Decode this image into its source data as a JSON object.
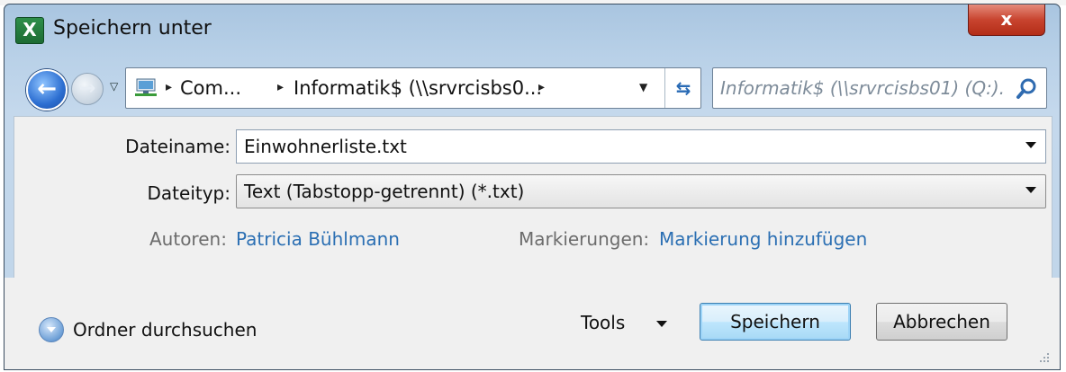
{
  "window": {
    "title": "Speichern unter",
    "app_icon_label": "X",
    "close_label": "x"
  },
  "nav": {
    "back_label": "←",
    "forward_label": "→",
    "dropdown_label": "▽",
    "breadcrumb": [
      "Com...",
      "Informatik$ (\\\\srvrcisbs0..."
    ],
    "arrow": "▸",
    "refresh_label": "⇆",
    "search_placeholder": "Informatik$ (\\\\srvrcisbs01) (Q:)..."
  },
  "form": {
    "filename_label": "Dateiname:",
    "filename_value": "Einwohnerliste.txt",
    "filetype_label": "Dateityp:",
    "filetype_value": "Text (Tabstopp-getrennt) (*.txt)",
    "authors_label": "Autoren:",
    "authors_value": "Patricia Bühlmann",
    "tags_label": "Markierungen:",
    "tags_value": "Markierung hinzufügen"
  },
  "footer": {
    "browse_label": "Ordner durchsuchen",
    "tools_label": "Tools",
    "save_label": "Speichern",
    "cancel_label": "Abbrechen"
  }
}
